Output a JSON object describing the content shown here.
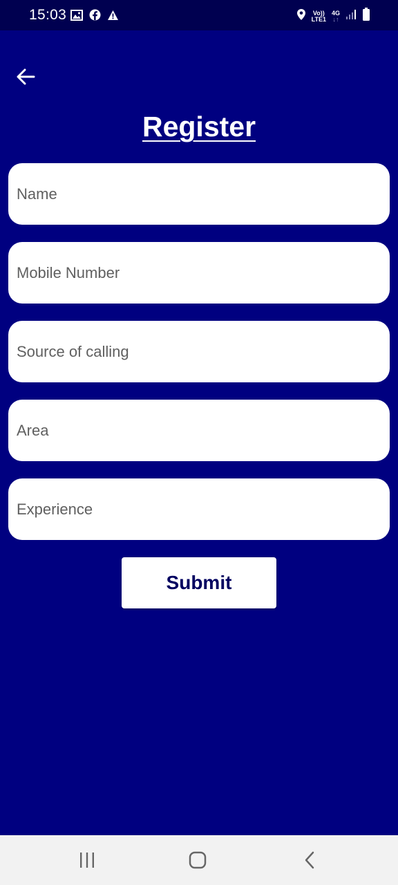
{
  "status_bar": {
    "time": "15:03",
    "volte_top": "Vo))",
    "volte_bottom": "LTE1",
    "network": "4G",
    "network_arrows": "↓↑"
  },
  "header": {
    "title": "Register"
  },
  "form": {
    "name_placeholder": "Name",
    "mobile_placeholder": "Mobile Number",
    "source_placeholder": "Source of calling",
    "area_placeholder": "Area",
    "experience_placeholder": "Experience",
    "submit_label": "Submit"
  },
  "colors": {
    "background": "#000080",
    "status_bar": "#000050",
    "field_background": "#ffffff",
    "submit_text": "#000060",
    "nav_bar": "#f2f2f2"
  }
}
